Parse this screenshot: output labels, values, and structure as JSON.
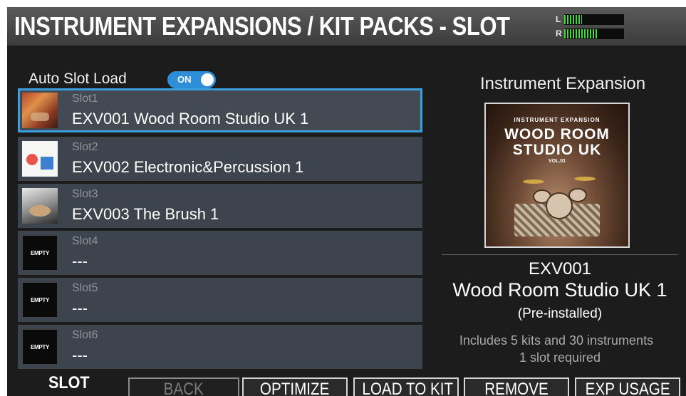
{
  "header": {
    "title": "INSTRUMENT EXPANSIONS / KIT PACKS - SLOT",
    "meter": {
      "left_label": "L",
      "right_label": "R",
      "left_level": 0.3,
      "right_level": 0.55,
      "color": "#45d640"
    }
  },
  "auto_slot": {
    "label": "Auto Slot Load",
    "toggle_label": "ON",
    "toggle_on": true,
    "accent": "#2f8ed8"
  },
  "slots": [
    {
      "slot": "Slot1",
      "name": "EXV001  Wood Room Studio UK 1",
      "thumb": "wood-room-cover",
      "selected": true
    },
    {
      "slot": "Slot2",
      "name": "EXV002 Electronic&Percussion 1",
      "thumb": "electronic-percussion-cover",
      "selected": false
    },
    {
      "slot": "Slot3",
      "name": "EXV003 The Brush 1",
      "thumb": "brush-cover",
      "selected": false
    },
    {
      "slot": "Slot4",
      "name": "---",
      "thumb": "empty",
      "thumb_text": "EMPTY",
      "selected": false
    },
    {
      "slot": "Slot5",
      "name": "---",
      "thumb": "empty",
      "thumb_text": "EMPTY",
      "selected": false
    },
    {
      "slot": "Slot6",
      "name": "---",
      "thumb": "empty",
      "thumb_text": "EMPTY",
      "selected": false
    }
  ],
  "detail": {
    "heading": "Instrument Expansion",
    "cover": {
      "small_text": "INSTRUMENT EXPANSION",
      "line1": "WOOD ROOM",
      "line2": "STUDIO UK",
      "vol": "VOL.01"
    },
    "code": "EXV001",
    "name": "Wood Room Studio UK 1",
    "status": "(Pre-installed)",
    "desc1": "Includes 5 kits and 30 instruments",
    "desc2": "1 slot required"
  },
  "function_bar": {
    "title": "SLOT",
    "buttons": [
      {
        "label": "BACK",
        "enabled": false
      },
      {
        "label": "OPTIMIZE",
        "enabled": true
      },
      {
        "label": "LOAD TO KIT",
        "enabled": true
      },
      {
        "label": "REMOVE",
        "enabled": true
      },
      {
        "label": "EXP USAGE",
        "enabled": true
      }
    ]
  },
  "colors": {
    "selection_border": "#3aa0e0",
    "slot_bg": "#3d444d",
    "screen_bg": "#1c1c1c"
  }
}
